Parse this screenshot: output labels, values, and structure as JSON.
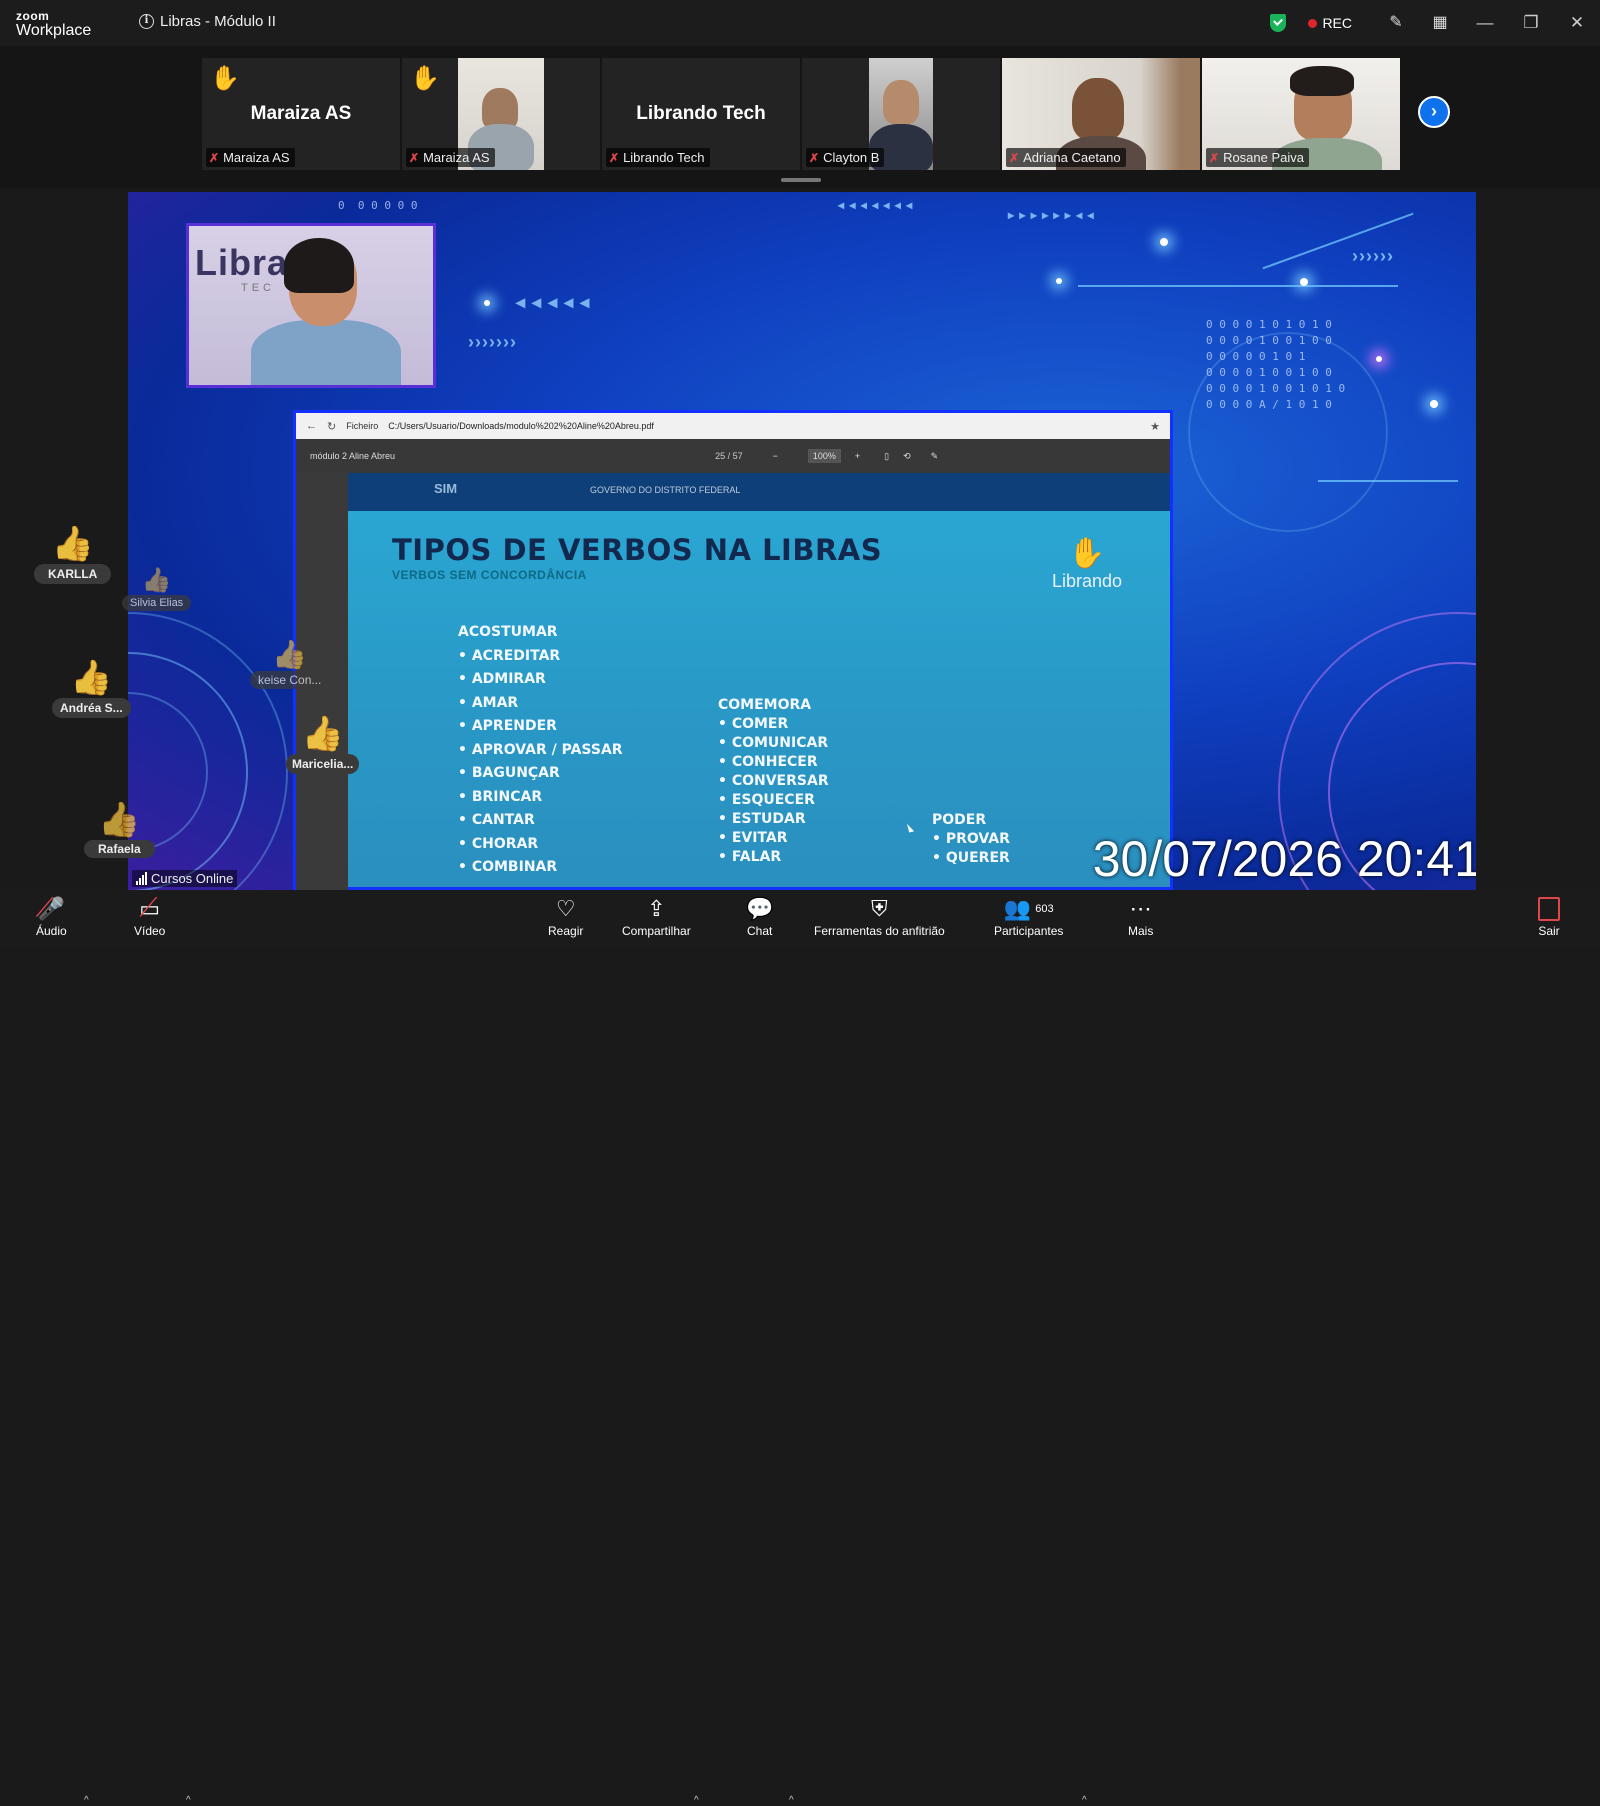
{
  "window": {
    "brand_top": "zoom",
    "brand_bottom": "Workplace",
    "meeting_title": "Libras - Módulo II",
    "rec_label": "REC",
    "minimize": "—",
    "restore": "❐",
    "close": "✕"
  },
  "strip": {
    "tiles": [
      {
        "big_name": "Maraiza AS",
        "caption": "Maraiza AS",
        "hand_raised": true,
        "video": false
      },
      {
        "big_name": "",
        "caption": "Maraiza AS",
        "hand_raised": true,
        "video": true
      },
      {
        "big_name": "Librando Tech",
        "caption": "Librando Tech",
        "hand_raised": false,
        "video": false
      },
      {
        "big_name": "",
        "caption": "Clayton B",
        "hand_raised": false,
        "video": true
      },
      {
        "big_name": "",
        "caption": "Adriana Caetano",
        "hand_raised": false,
        "video": true
      },
      {
        "big_name": "",
        "caption": "Rosane Paiva",
        "hand_raised": false,
        "video": true
      }
    ],
    "next_icon": "chevron-right-icon"
  },
  "share": {
    "presenter_watermark": "Libra",
    "presenter_watermark_sub": "TEC",
    "browser_url": "C:/Users/Usuario/Downloads/modulo%202%20Aline%20Abreu.pdf",
    "browser_site_label": "Ficheiro",
    "pdf_filename": "módulo 2 Aline Abreu",
    "pdf_page": "25 / 57",
    "pdf_zoom": "100%",
    "slide_header_logo": "SIM",
    "slide_header_text": "GOVERNO DO DISTRITO FEDERAL",
    "slide_title": "TIPOS DE VERBOS NA LIBRAS",
    "slide_subtitle": "VERBOS SEM CONCORDÂNCIA",
    "slide_logo_text": "Librando",
    "col1_head": "ACOSTUMAR",
    "col1_items": [
      "ACREDITAR",
      "ADMIRAR",
      "AMAR",
      "APRENDER",
      "APROVAR / PASSAR",
      "BAGUNÇAR",
      "BRINCAR",
      "CANTAR",
      "CHORAR",
      "COMBINAR"
    ],
    "col2_head": "COMEMORA",
    "col2_items": [
      "COMER",
      "COMUNICAR",
      "CONHECER",
      "CONVERSAR",
      "ESQUECER",
      "ESTUDAR",
      "EVITAR",
      "FALAR"
    ],
    "col3_head": "PODER",
    "col3_items": [
      "PROVAR",
      "QUERER"
    ],
    "timestamp": "30/07/2026 20:41"
  },
  "reactions": [
    {
      "name": "KARLLA"
    },
    {
      "name": "Silvia Elias"
    },
    {
      "name": "keise Con..."
    },
    {
      "name": "Andréa S..."
    },
    {
      "name": "Maricelia..."
    },
    {
      "name": "Rafaela"
    }
  ],
  "network_label": "Cursos Online",
  "toolbar": {
    "audio": "Áudio",
    "video": "Vídeo",
    "react": "Reagir",
    "share": "Compartilhar",
    "chat": "Chat",
    "host_tools": "Ferramentas do anfitrião",
    "participants": "Participantes",
    "participants_count": "603",
    "more": "Mais",
    "leave": "Sair"
  },
  "colors": {
    "accent": "#0e72ed",
    "rec": "#e0252f",
    "muted": "#e0474c",
    "shield": "#1ab35a"
  }
}
